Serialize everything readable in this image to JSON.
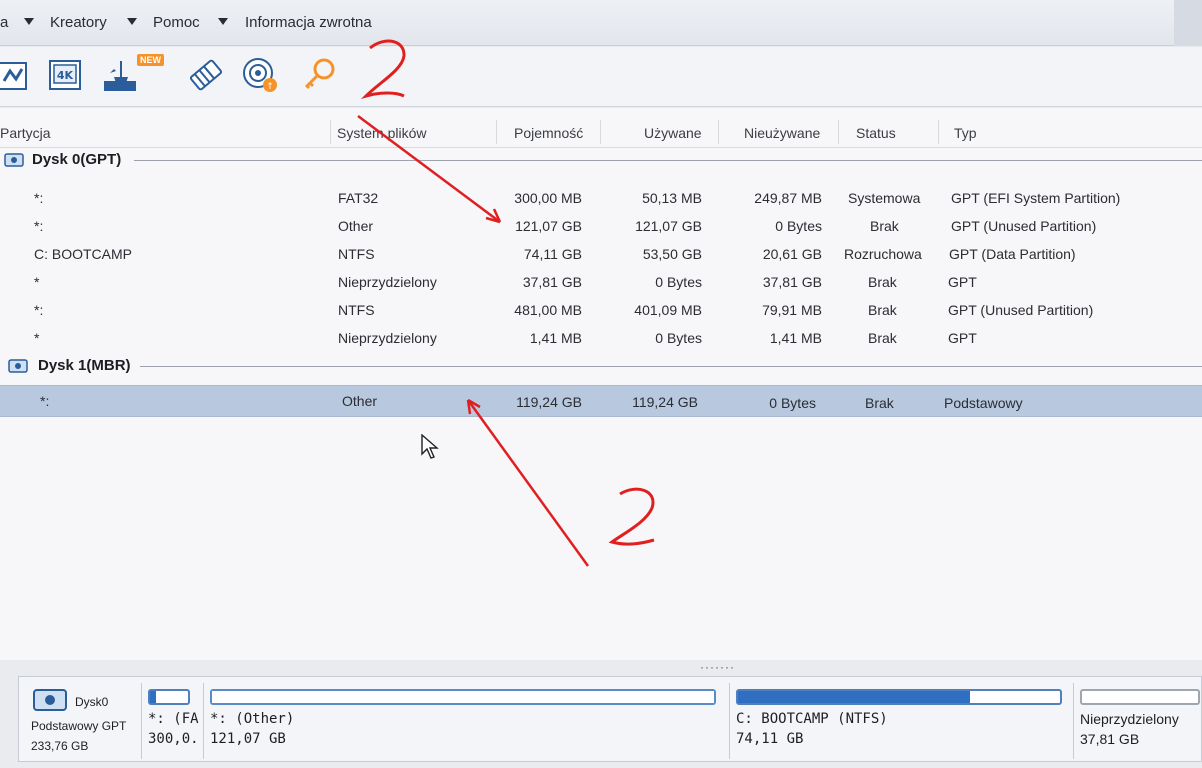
{
  "menu": {
    "items": [
      "a",
      "Kreatory",
      "Pomoc",
      "Informacja zwrotna"
    ]
  },
  "toolbar": {
    "new_badge": "NEW",
    "icons": [
      "partition-wizard-icon",
      "4k-align-icon",
      "disk-cleanup-icon",
      "eraser-icon",
      "disk-recovery-icon",
      "license-key-icon"
    ]
  },
  "table": {
    "headers": {
      "partition": "Partycja",
      "filesystem": "System plików",
      "capacity": "Pojemność",
      "used": "Używane",
      "unused": "Nieużywane",
      "status": "Status",
      "type": "Typ"
    },
    "disks": [
      {
        "label": "Dysk 0(GPT)",
        "partitions": [
          {
            "name": "*:",
            "fs": "FAT32",
            "capacity": "300,00 MB",
            "used": "50,13 MB",
            "unused": "249,87 MB",
            "status": "Systemowa",
            "type": "GPT (EFI System Partition)"
          },
          {
            "name": "*:",
            "fs": "Other",
            "capacity": "121,07 GB",
            "used": "121,07 GB",
            "unused": "0 Bytes",
            "status": "Brak",
            "type": "GPT (Unused Partition)"
          },
          {
            "name": "C: BOOTCAMP",
            "fs": "NTFS",
            "capacity": "74,11 GB",
            "used": "53,50 GB",
            "unused": "20,61 GB",
            "status": "Rozruchowa",
            "type": "GPT (Data Partition)"
          },
          {
            "name": "*",
            "fs": "Nieprzydzielony",
            "capacity": "37,81 GB",
            "used": "0 Bytes",
            "unused": "37,81 GB",
            "status": "Brak",
            "type": "GPT"
          },
          {
            "name": "*:",
            "fs": "NTFS",
            "capacity": "481,00 MB",
            "used": "401,09 MB",
            "unused": "79,91 MB",
            "status": "Brak",
            "type": "GPT (Unused Partition)"
          },
          {
            "name": "*",
            "fs": "Nieprzydzielony",
            "capacity": "1,41 MB",
            "used": "0 Bytes",
            "unused": "1,41 MB",
            "status": "Brak",
            "type": "GPT"
          }
        ]
      },
      {
        "label": "Dysk 1(MBR)",
        "partitions": [
          {
            "name": "*:",
            "fs": "Other",
            "capacity": "119,24 GB",
            "used": "119,24 GB",
            "unused": "0 Bytes",
            "status": "Brak",
            "type": "Podstawowy",
            "selected": true
          }
        ]
      }
    ]
  },
  "splitter": "·······",
  "diskmap": {
    "disk": {
      "name": "Dysk0",
      "type": "Podstawowy GPT",
      "size": "233,76 GB"
    },
    "parts": [
      {
        "label": "*: (FA",
        "size": "300,0..",
        "fill": 0.17
      },
      {
        "label": "*: (Other)",
        "size": "121,07 GB",
        "fill": 1.0
      },
      {
        "label": "C: BOOTCAMP (NTFS)",
        "size": "74,11 GB",
        "fill": 0.72
      },
      {
        "label": "Nieprzydzielony",
        "size": "37,81 GB",
        "fill": 0
      }
    ]
  },
  "annotations": {
    "marks": [
      "2",
      "2"
    ],
    "color": "#e02020"
  }
}
